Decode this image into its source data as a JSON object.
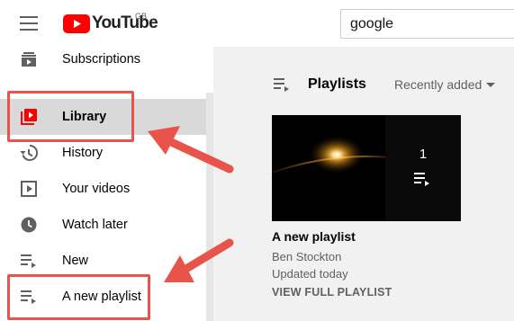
{
  "header": {
    "logo_text": "YouTube",
    "logo_country": "GB",
    "search_hint": "blurred",
    "search_value": "google",
    "brand_color": "#ff0000"
  },
  "sidebar": {
    "items": [
      {
        "label": "Subscriptions",
        "icon": "subscriptions-icon"
      },
      {
        "label": "Library",
        "icon": "library-icon",
        "active": true
      },
      {
        "label": "History",
        "icon": "history-icon"
      },
      {
        "label": "Your videos",
        "icon": "your-videos-icon"
      },
      {
        "label": "Watch later",
        "icon": "watch-later-icon"
      },
      {
        "label": "New",
        "icon": "playlist-icon"
      },
      {
        "label": "A new playlist",
        "icon": "playlist-icon"
      }
    ]
  },
  "main": {
    "section_title": "Playlists",
    "sort_label": "Recently added",
    "playlist": {
      "video_count": "1",
      "title": "A new playlist",
      "owner": "Ben Stockton",
      "updated": "Updated today",
      "view_link": "VIEW FULL PLAYLIST"
    }
  },
  "annotations": {
    "highlight_color": "#e8534a"
  }
}
